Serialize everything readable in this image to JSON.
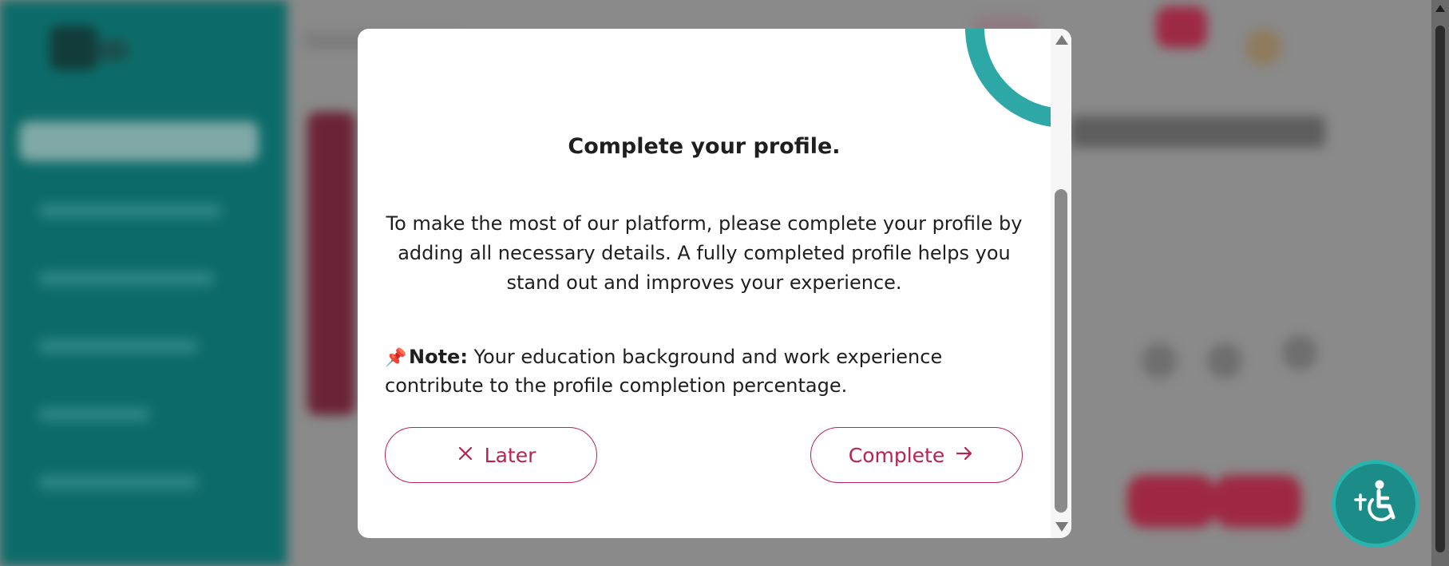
{
  "modal": {
    "title": "Complete your profile.",
    "body": "To make the most of our platform, please complete your profile by adding all necessary details. A fully completed profile helps you stand out and improves your experience.",
    "note": {
      "icon": "pin-icon",
      "label": "Note:",
      "text": " Your education background and work experience contribute to the profile completion percentage."
    },
    "buttons": {
      "later_label": "Later",
      "later_icon": "close-icon",
      "complete_label": "Complete",
      "complete_icon": "arrow-right-icon"
    }
  },
  "accessibility": {
    "icon": "accessibility-wheelchair-icon"
  },
  "colors": {
    "accent": "#b8234f",
    "teal": "#2ea8a7",
    "sidebar": "#0c6b69"
  }
}
